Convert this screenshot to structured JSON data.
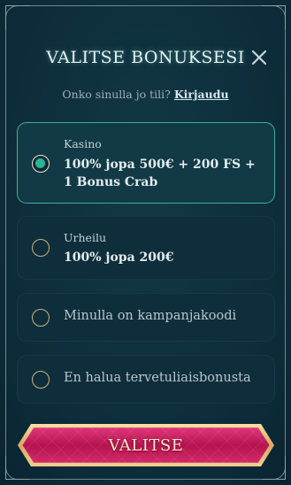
{
  "header": {
    "title": "VALITSE BONUKSESI",
    "close_icon": "close-icon"
  },
  "login_prompt": {
    "text": "Onko sinulla jo tili?",
    "link": "Kirjaudu"
  },
  "options": [
    {
      "label": "Kasino",
      "value_line1": "100% jopa 500€ + 200 FS +",
      "value_line2": "1 Bonus Crab",
      "selected": true
    },
    {
      "label": "Urheilu",
      "value_line1": "100% jopa 200€",
      "selected": false
    },
    {
      "text": "Minulla on kampanjakoodi",
      "selected": false
    },
    {
      "text": "En halua tervetuliaisbonusta",
      "selected": false
    }
  ],
  "cta": {
    "label": "VALITSE"
  },
  "colors": {
    "background": "#0d2c3a",
    "selected_border": "#3fae9d",
    "radio_fill": "#2bb596",
    "button_pink": "#c3195f",
    "button_gold": "#e8c27a"
  }
}
